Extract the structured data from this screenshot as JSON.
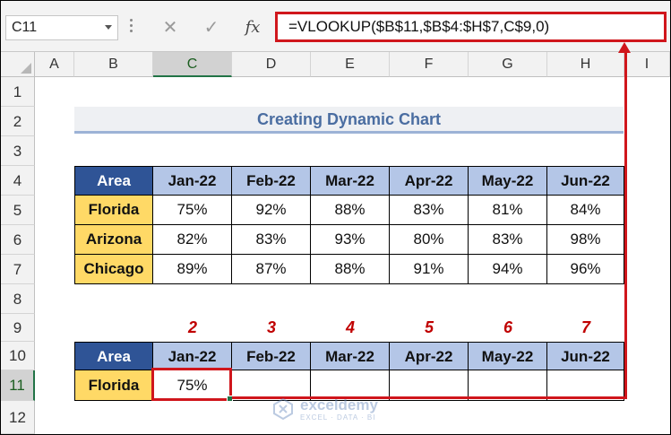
{
  "formula_bar": {
    "name_box": "C11",
    "cancel_icon": "✕",
    "enter_icon": "✓",
    "fx_label": "fx",
    "formula": "=VLOOKUP($B$11,$B$4:$H$7,C$9,0)"
  },
  "columns": [
    "A",
    "B",
    "C",
    "D",
    "E",
    "F",
    "G",
    "H",
    "I"
  ],
  "selected_column": "C",
  "rows": [
    "1",
    "2",
    "3",
    "4",
    "5",
    "6",
    "7",
    "8",
    "9",
    "10",
    "11",
    "12"
  ],
  "selected_row": "11",
  "title": "Creating Dynamic Chart",
  "main_table": {
    "header_area": "Area",
    "months": [
      "Jan-22",
      "Feb-22",
      "Mar-22",
      "Apr-22",
      "May-22",
      "Jun-22"
    ],
    "rows": [
      {
        "area": "Florida",
        "values": [
          "75%",
          "92%",
          "88%",
          "83%",
          "81%",
          "84%"
        ]
      },
      {
        "area": "Arizona",
        "values": [
          "82%",
          "83%",
          "93%",
          "80%",
          "83%",
          "98%"
        ]
      },
      {
        "area": "Chicago",
        "values": [
          "89%",
          "87%",
          "88%",
          "91%",
          "94%",
          "96%"
        ]
      }
    ]
  },
  "column_numbers": [
    "2",
    "3",
    "4",
    "5",
    "6",
    "7"
  ],
  "lookup_table": {
    "header_area": "Area",
    "months": [
      "Jan-22",
      "Feb-22",
      "Mar-22",
      "Apr-22",
      "May-22",
      "Jun-22"
    ],
    "row": {
      "area": "Florida",
      "values": [
        "75%",
        "",
        "",
        "",
        "",
        ""
      ]
    }
  },
  "watermark": {
    "name": "exceldemy",
    "tagline": "EXCEL · DATA · BI"
  },
  "colors": {
    "highlight_red": "#d0161c",
    "header_dark_blue": "#2f5496",
    "header_light_blue": "#b4c6e7",
    "area_yellow": "#ffd966",
    "number_red": "#c00000"
  }
}
